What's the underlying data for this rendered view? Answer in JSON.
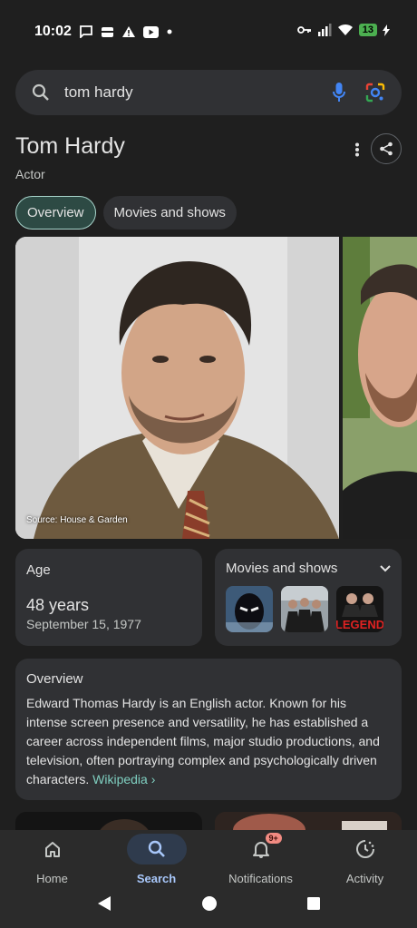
{
  "status_bar": {
    "time": "10:02",
    "battery": "13",
    "icons": [
      "chat-icon",
      "wallet-icon",
      "warning-icon",
      "youtube-icon",
      "dot-icon",
      "key-icon",
      "signal-icon",
      "wifi-icon",
      "battery-icon"
    ]
  },
  "search": {
    "query": "tom hardy",
    "icons": [
      "search-icon",
      "mic-icon",
      "lens-icon"
    ]
  },
  "entity": {
    "title": "Tom Hardy",
    "subtitle": "Actor"
  },
  "chips": [
    {
      "label": "Overview",
      "active": true
    },
    {
      "label": "Movies and shows",
      "active": false
    }
  ],
  "gallery": {
    "source": "Source: House & Garden"
  },
  "age_card": {
    "label": "Age",
    "value": "48 years",
    "date": "September 15, 1977"
  },
  "movies_card": {
    "label": "Movies and shows",
    "thumb_texts": [
      "LEGEND"
    ]
  },
  "overview_card": {
    "label": "Overview",
    "text": "Edward Thomas Hardy is an English actor. Known for his intense screen presence and versatility, he has established a career across independent films, major studio productions, and television, often portraying complex and psychologically driven characters. ",
    "link": "Wikipedia ›"
  },
  "bottom_nav": {
    "items": [
      {
        "label": "Home",
        "icon": "home-icon",
        "active": false
      },
      {
        "label": "Search",
        "icon": "search-icon",
        "active": true
      },
      {
        "label": "Notifications",
        "icon": "bell-icon",
        "active": false,
        "badge": "9+"
      },
      {
        "label": "Activity",
        "icon": "activity-icon",
        "active": false
      }
    ]
  },
  "colors": {
    "background": "#1f1f1f",
    "card": "#303134",
    "accent_link": "#7fcfc0",
    "active_nav": "#a8c7fa"
  }
}
